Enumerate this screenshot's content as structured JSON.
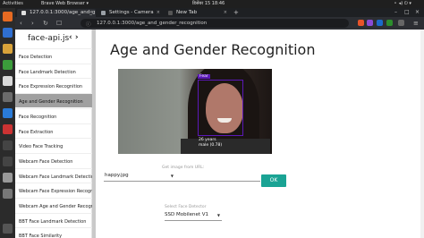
{
  "os": {
    "activities": "Activities",
    "app_menu": "Brave Web Browser ▾",
    "clock": "डिसेंबर 15  18:46",
    "tray": "⚬ ◂) ⏻ ▾"
  },
  "browser": {
    "tabs": [
      {
        "label": "127.0.0.1:3000/age_and_g",
        "fav_color": "#e0e0e0",
        "active": true
      },
      {
        "label": "Settings - Camera",
        "fav_color": "#9aa0a6",
        "active": false
      },
      {
        "label": "New Tab",
        "fav_color": "#555",
        "active": false
      }
    ],
    "new_tab": "+",
    "close_glyph": "×",
    "url": "127.0.0.1:3000/age_and_gender_recognition",
    "back": "‹",
    "forward": "›",
    "reload": "↻",
    "bookmark": "☐",
    "shield": "⊘",
    "win_min": "–",
    "win_max": "□",
    "win_close": "×"
  },
  "sidebar": {
    "brand": "face-api.js",
    "nav_glyph": "‹ ›",
    "items": [
      "Face Detection",
      "Face Landmark Detection",
      "Face Expression Recognition",
      "Age and Gender Recognition",
      "Face Recognition",
      "Face Extraction",
      "Video Face Tracking",
      "Webcam Face Detection",
      "Webcam Face Landmark Detection",
      "Webcam Face Expression Recognition",
      "Webcam Age and Gender Recognition",
      "BBT Face Landmark Detection",
      "BBT Face Similarity"
    ],
    "selected_index": 3
  },
  "main": {
    "title": "Age and Gender Recognition",
    "detection": {
      "tag": "Fear",
      "age": "26 years",
      "gender": "male (0.78)"
    },
    "image_select": {
      "value": "happy.jpg"
    },
    "url_field": {
      "label": "Get image from URL:",
      "value": ""
    },
    "ok_label": "OK",
    "detector": {
      "label": "Select Face Detector",
      "value": "SSD Mobilenet V1"
    }
  }
}
